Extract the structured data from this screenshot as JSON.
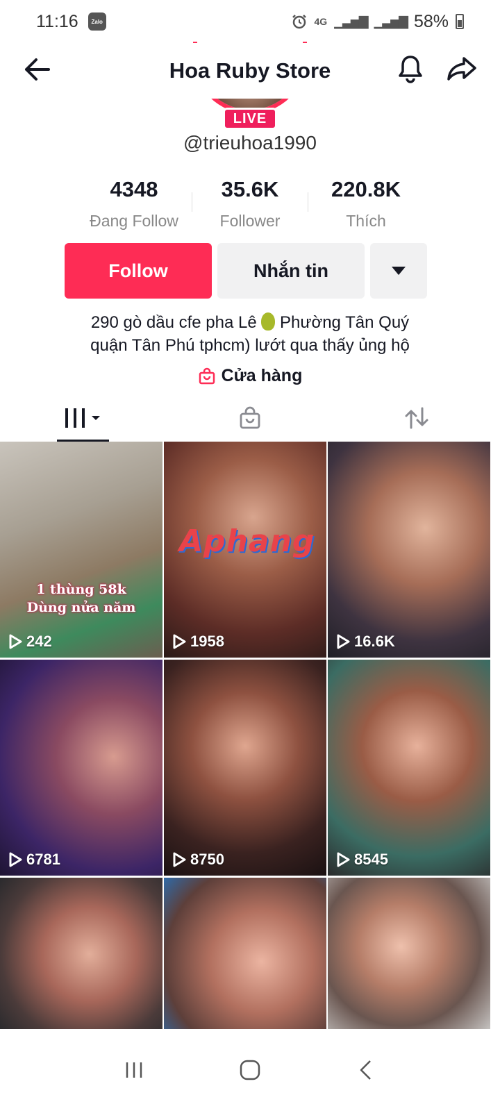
{
  "status_bar": {
    "time": "11:16",
    "zalo": "Zalo",
    "network": "4G",
    "battery": "58%"
  },
  "header": {
    "title": "Hoa Ruby Store"
  },
  "profile": {
    "live_label": "LIVE",
    "username": "@trieuhoa1990"
  },
  "stats": [
    {
      "value": "4348",
      "label": "Đang Follow"
    },
    {
      "value": "35.6K",
      "label": "Follower"
    },
    {
      "value": "220.8K",
      "label": "Thích"
    }
  ],
  "buttons": {
    "follow": "Follow",
    "message": "Nhắn tin"
  },
  "bio": {
    "line1_before": "290 gò dầu cfe pha Lê",
    "line1_after": "Phường Tân Quý",
    "line2": "quận Tân Phú tphcm) lướt qua thấy ủng hộ"
  },
  "shop": {
    "label": "Cửa hàng"
  },
  "tabs": [
    {
      "icon": "grid-icon",
      "active": true
    },
    {
      "icon": "shopping-bag-icon",
      "active": false
    },
    {
      "icon": "repost-icon",
      "active": false
    }
  ],
  "videos": [
    {
      "views": "242",
      "caption_line1": "1 thùng 58k",
      "caption_line2": "Dùng nửa năm"
    },
    {
      "views": "1958",
      "watermark": "Aphang"
    },
    {
      "views": "16.6K"
    },
    {
      "views": "6781"
    },
    {
      "views": "8750"
    },
    {
      "views": "8545"
    },
    {
      "views": ""
    },
    {
      "views": ""
    },
    {
      "views": ""
    }
  ],
  "colors": {
    "accent": "#fe2c55",
    "text": "#161823",
    "secondary_text": "#888888",
    "button_gray": "#f1f1f2"
  }
}
